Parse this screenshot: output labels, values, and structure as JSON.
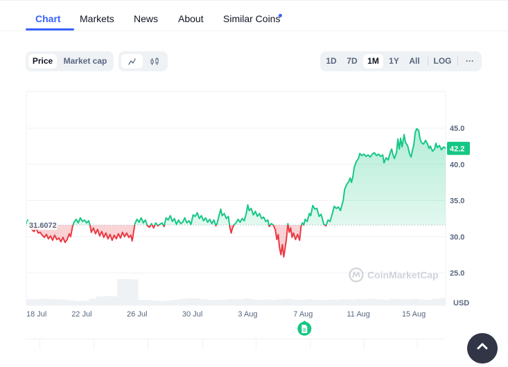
{
  "tabs": [
    {
      "label": "Chart",
      "active": true
    },
    {
      "label": "Markets",
      "active": false
    },
    {
      "label": "News",
      "active": false
    },
    {
      "label": "About",
      "active": false
    },
    {
      "label": "Similar Coins",
      "active": false,
      "has_dot": true
    }
  ],
  "toolbar": {
    "metric_toggle": [
      {
        "label": "Price",
        "active": true
      },
      {
        "label": "Market cap",
        "active": false
      }
    ],
    "chart_type_toggle": [
      {
        "icon": "line-chart-icon",
        "active": true
      },
      {
        "icon": "candlestick-icon",
        "active": false
      }
    ],
    "ranges": [
      {
        "label": "1D",
        "active": false
      },
      {
        "label": "7D",
        "active": false
      },
      {
        "label": "1M",
        "active": true
      },
      {
        "label": "1Y",
        "active": false
      },
      {
        "label": "All",
        "active": false
      }
    ],
    "log_label": "LOG",
    "more_label": "···"
  },
  "colors": {
    "accent": "#3861fb",
    "up": "#16c784",
    "down": "#ea3943",
    "axis_text": "#58667e"
  },
  "watermark": "CoinMarketCap",
  "news_marker_icon": "document-icon",
  "chart_data": {
    "type": "line",
    "title": "",
    "currency_label": "USD",
    "baseline_value": 31.6072,
    "baseline_label": "31.6072",
    "current_value_label": "42.2",
    "current_value": 42.2,
    "ylim": [
      22.5,
      49
    ],
    "y_ticks": [
      {
        "value": 45.0,
        "label": "45.0"
      },
      {
        "value": 40.0,
        "label": "40.0"
      },
      {
        "value": 35.0,
        "label": "35.0"
      },
      {
        "value": 30.0,
        "label": "30.0"
      },
      {
        "value": 25.0,
        "label": "25.0"
      }
    ],
    "xlim": [
      0,
      30.3
    ],
    "x_ticks": [
      {
        "day": 0,
        "label": "18 Jul"
      },
      {
        "day": 4,
        "label": "22 Jul"
      },
      {
        "day": 8,
        "label": "26 Jul"
      },
      {
        "day": 12,
        "label": "30 Jul"
      },
      {
        "day": 16,
        "label": "3 Aug"
      },
      {
        "day": 20,
        "label": "7 Aug"
      },
      {
        "day": 24,
        "label": "11 Aug"
      },
      {
        "day": 28,
        "label": "15 Aug"
      }
    ],
    "news_marker_day": 20.1,
    "series": [
      {
        "name": "Price",
        "points": [
          [
            0.0,
            31.8
          ],
          [
            0.1,
            32.3
          ],
          [
            0.25,
            31.4
          ],
          [
            0.4,
            31.0
          ],
          [
            0.55,
            30.7
          ],
          [
            0.7,
            31.2
          ],
          [
            0.85,
            30.5
          ],
          [
            1.0,
            30.6
          ],
          [
            1.15,
            30.2
          ],
          [
            1.3,
            29.9
          ],
          [
            1.45,
            30.3
          ],
          [
            1.6,
            29.7
          ],
          [
            1.75,
            30.1
          ],
          [
            1.9,
            29.5
          ],
          [
            2.05,
            30.2
          ],
          [
            2.2,
            29.6
          ],
          [
            2.35,
            29.8
          ],
          [
            2.5,
            29.3
          ],
          [
            2.65,
            29.9
          ],
          [
            2.8,
            29.2
          ],
          [
            2.95,
            29.6
          ],
          [
            3.1,
            30.4
          ],
          [
            3.2,
            30.0
          ],
          [
            3.35,
            31.5
          ],
          [
            3.45,
            32.0
          ],
          [
            3.6,
            32.4
          ],
          [
            3.75,
            31.9
          ],
          [
            3.9,
            32.6
          ],
          [
            4.05,
            32.1
          ],
          [
            4.2,
            32.3
          ],
          [
            4.35,
            31.9
          ],
          [
            4.5,
            32.2
          ],
          [
            4.6,
            31.6
          ],
          [
            4.7,
            30.6
          ],
          [
            4.85,
            31.2
          ],
          [
            5.0,
            30.4
          ],
          [
            5.15,
            31.0
          ],
          [
            5.3,
            30.1
          ],
          [
            5.45,
            30.7
          ],
          [
            5.6,
            29.9
          ],
          [
            5.75,
            30.5
          ],
          [
            5.9,
            29.7
          ],
          [
            6.05,
            30.3
          ],
          [
            6.2,
            29.5
          ],
          [
            6.35,
            30.2
          ],
          [
            6.5,
            29.7
          ],
          [
            6.65,
            30.4
          ],
          [
            6.8,
            29.8
          ],
          [
            6.95,
            30.6
          ],
          [
            7.1,
            30.0
          ],
          [
            7.25,
            30.5
          ],
          [
            7.4,
            29.9
          ],
          [
            7.55,
            30.2
          ],
          [
            7.65,
            29.4
          ],
          [
            7.75,
            30.6
          ],
          [
            7.85,
            31.8
          ],
          [
            8.0,
            32.4
          ],
          [
            8.15,
            32.0
          ],
          [
            8.3,
            32.6
          ],
          [
            8.45,
            31.9
          ],
          [
            8.6,
            32.3
          ],
          [
            8.75,
            31.5
          ],
          [
            8.9,
            31.3
          ],
          [
            9.05,
            31.8
          ],
          [
            9.2,
            31.2
          ],
          [
            9.35,
            31.9
          ],
          [
            9.5,
            31.5
          ],
          [
            9.65,
            31.7
          ],
          [
            9.8,
            31.9
          ],
          [
            9.95,
            31.4
          ],
          [
            10.1,
            32.6
          ],
          [
            10.25,
            32.3
          ],
          [
            10.4,
            32.9
          ],
          [
            10.55,
            32.1
          ],
          [
            10.7,
            32.5
          ],
          [
            10.85,
            31.7
          ],
          [
            11.0,
            32.3
          ],
          [
            11.15,
            31.8
          ],
          [
            11.3,
            32.0
          ],
          [
            11.45,
            32.6
          ],
          [
            11.6,
            31.9
          ],
          [
            11.75,
            32.2
          ],
          [
            11.9,
            31.7
          ],
          [
            12.05,
            33.0
          ],
          [
            12.2,
            32.8
          ],
          [
            12.35,
            33.3
          ],
          [
            12.5,
            32.5
          ],
          [
            12.65,
            32.9
          ],
          [
            12.8,
            32.2
          ],
          [
            12.95,
            32.6
          ],
          [
            13.1,
            32.0
          ],
          [
            13.25,
            32.4
          ],
          [
            13.4,
            31.8
          ],
          [
            13.55,
            32.3
          ],
          [
            13.7,
            31.5
          ],
          [
            13.8,
            31.9
          ],
          [
            13.9,
            32.7
          ],
          [
            14.05,
            33.8
          ],
          [
            14.15,
            32.9
          ],
          [
            14.3,
            33.2
          ],
          [
            14.45,
            32.5
          ],
          [
            14.6,
            32.8
          ],
          [
            14.7,
            31.4
          ],
          [
            14.8,
            30.5
          ],
          [
            14.9,
            31.2
          ],
          [
            15.0,
            31.6
          ],
          [
            15.15,
            31.9
          ],
          [
            15.3,
            32.4
          ],
          [
            15.45,
            32.0
          ],
          [
            15.6,
            32.5
          ],
          [
            15.75,
            32.2
          ],
          [
            15.9,
            33.3
          ],
          [
            16.0,
            34.4
          ],
          [
            16.1,
            33.6
          ],
          [
            16.25,
            33.9
          ],
          [
            16.4,
            33.0
          ],
          [
            16.55,
            33.5
          ],
          [
            16.7,
            32.8
          ],
          [
            16.85,
            33.2
          ],
          [
            17.0,
            32.5
          ],
          [
            17.15,
            32.7
          ],
          [
            17.3,
            32.1
          ],
          [
            17.45,
            32.3
          ],
          [
            17.55,
            31.4
          ],
          [
            17.7,
            31.8
          ],
          [
            17.85,
            31.6
          ],
          [
            18.0,
            30.9
          ],
          [
            18.1,
            29.6
          ],
          [
            18.2,
            30.3
          ],
          [
            18.3,
            28.4
          ],
          [
            18.4,
            27.5
          ],
          [
            18.5,
            28.9
          ],
          [
            18.6,
            27.2
          ],
          [
            18.7,
            28.4
          ],
          [
            18.8,
            29.8
          ],
          [
            18.9,
            31.8
          ],
          [
            19.0,
            30.6
          ],
          [
            19.1,
            31.2
          ],
          [
            19.2,
            29.9
          ],
          [
            19.3,
            30.5
          ],
          [
            19.45,
            29.6
          ],
          [
            19.6,
            30.3
          ],
          [
            19.75,
            29.5
          ],
          [
            19.85,
            31.4
          ],
          [
            19.95,
            31.9
          ],
          [
            20.05,
            31.6
          ],
          [
            20.15,
            32.4
          ],
          [
            20.3,
            32.1
          ],
          [
            20.45,
            33.2
          ],
          [
            20.55,
            32.9
          ],
          [
            20.7,
            34.3
          ],
          [
            20.85,
            33.8
          ],
          [
            21.0,
            33.9
          ],
          [
            21.15,
            32.8
          ],
          [
            21.3,
            33.1
          ],
          [
            21.4,
            32.4
          ],
          [
            21.5,
            31.7
          ],
          [
            21.65,
            31.5
          ],
          [
            21.8,
            32.3
          ],
          [
            21.95,
            32.1
          ],
          [
            22.1,
            33.1
          ],
          [
            22.25,
            34.2
          ],
          [
            22.4,
            33.9
          ],
          [
            22.55,
            34.1
          ],
          [
            22.7,
            33.6
          ],
          [
            22.8,
            34.3
          ],
          [
            22.9,
            35.0
          ],
          [
            23.0,
            36.5
          ],
          [
            23.15,
            37.2
          ],
          [
            23.3,
            37.6
          ],
          [
            23.4,
            38.1
          ],
          [
            23.5,
            37.5
          ],
          [
            23.6,
            38.3
          ],
          [
            23.7,
            39.6
          ],
          [
            23.85,
            40.4
          ],
          [
            24.0,
            40.8
          ],
          [
            24.1,
            41.5
          ],
          [
            24.25,
            41.2
          ],
          [
            24.4,
            41.4
          ],
          [
            24.55,
            41.1
          ],
          [
            24.7,
            41.3
          ],
          [
            24.85,
            41.0
          ],
          [
            25.0,
            41.4
          ],
          [
            25.15,
            41.6
          ],
          [
            25.3,
            41.2
          ],
          [
            25.45,
            41.4
          ],
          [
            25.6,
            41.1
          ],
          [
            25.75,
            41.3
          ],
          [
            25.85,
            40.2
          ],
          [
            26.0,
            40.9
          ],
          [
            26.15,
            40.6
          ],
          [
            26.3,
            41.6
          ],
          [
            26.4,
            42.1
          ],
          [
            26.5,
            41.3
          ],
          [
            26.6,
            40.8
          ],
          [
            26.75,
            41.6
          ],
          [
            26.85,
            43.5
          ],
          [
            26.95,
            42.1
          ],
          [
            27.05,
            43.6
          ],
          [
            27.15,
            42.4
          ],
          [
            27.3,
            44.1
          ],
          [
            27.4,
            43.0
          ],
          [
            27.55,
            42.6
          ],
          [
            27.7,
            41.4
          ],
          [
            27.8,
            41.0
          ],
          [
            27.9,
            41.9
          ],
          [
            28.0,
            42.7
          ],
          [
            28.1,
            44.4
          ],
          [
            28.2,
            44.9
          ],
          [
            28.35,
            44.7
          ],
          [
            28.45,
            43.5
          ],
          [
            28.55,
            43.0
          ],
          [
            28.7,
            42.8
          ],
          [
            28.85,
            43.3
          ],
          [
            29.0,
            42.8
          ],
          [
            29.1,
            42.2
          ],
          [
            29.2,
            42.5
          ],
          [
            29.35,
            41.8
          ],
          [
            29.5,
            42.1
          ],
          [
            29.6,
            42.9
          ],
          [
            29.7,
            42.3
          ],
          [
            29.85,
            42.6
          ],
          [
            30.0,
            42.0
          ],
          [
            30.15,
            42.4
          ],
          [
            30.3,
            42.2
          ]
        ]
      }
    ],
    "volume": {
      "ylim": [
        0,
        1
      ],
      "values": [
        0.22,
        0.22,
        0.24,
        0.23,
        0.22,
        0.21,
        0.18,
        0.16,
        0.17,
        0.24,
        0.32,
        0.34,
        0.33,
        0.95,
        0.95,
        0.94,
        0.2,
        0.19,
        0.17,
        0.16,
        0.18,
        0.2,
        0.24,
        0.26,
        0.25,
        0.22,
        0.2,
        0.2,
        0.21,
        0.23,
        0.22,
        0.25,
        0.22,
        0.2,
        0.21,
        0.2,
        0.22,
        0.24,
        0.21,
        0.2,
        0.22,
        0.2,
        0.19,
        0.21,
        0.2,
        0.22,
        0.21,
        0.23,
        0.22,
        0.24,
        0.22,
        0.2,
        0.24,
        0.23,
        0.22,
        0.24,
        0.21,
        0.2,
        0.24,
        0.26
      ]
    }
  }
}
